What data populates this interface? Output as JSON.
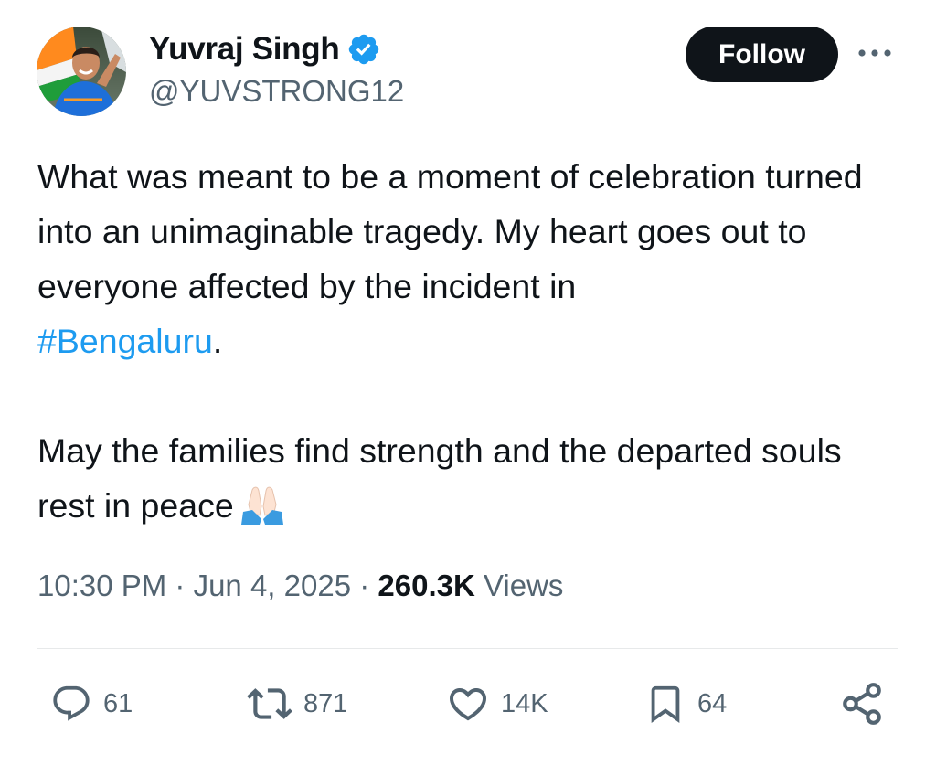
{
  "author": {
    "display_name": "Yuvraj Singh",
    "handle": "@YUVSTRONG12",
    "verified": true,
    "avatar_icon": "profile-photo"
  },
  "header": {
    "follow_label": "Follow",
    "more_icon": "more-horizontal-icon"
  },
  "tweet": {
    "line_1": "What was meant to be a moment of celebration turned into an unimaginable tragedy. My heart goes out to everyone affected by the incident in",
    "hashtag": "#Bengaluru",
    "line_1_end": ".",
    "line_2": "May the families find strength and the departed souls rest in peace",
    "emoji": "🙏🏻"
  },
  "meta": {
    "time": "10:30 PM",
    "separator": " · ",
    "date": "Jun 4, 2025",
    "views_count": "260.3K",
    "views_label": "Views"
  },
  "actions": {
    "replies": "61",
    "reposts": "871",
    "likes": "14K",
    "bookmarks": "64"
  },
  "colors": {
    "text": "#0f1419",
    "secondary": "#536471",
    "link": "#1d9bf0",
    "verified": "#1d9bf0",
    "divider": "#e7e9ea"
  }
}
